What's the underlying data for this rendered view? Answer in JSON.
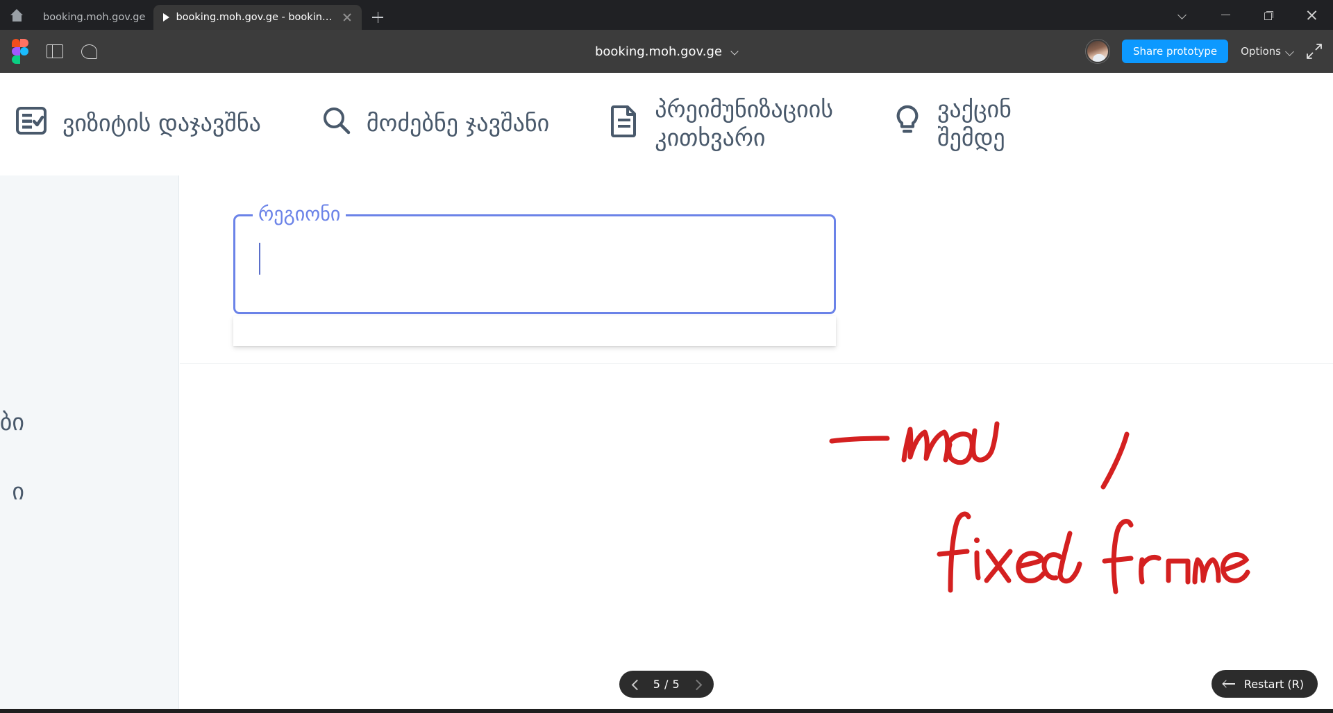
{
  "browser": {
    "home_icon": "home-icon",
    "tabs": [
      {
        "title": "booking.moh.gov.ge",
        "active": false,
        "playing": false
      },
      {
        "title": "booking.moh.gov.ge - booking.moh....",
        "active": true,
        "playing": true
      }
    ],
    "new_tab_label": "+",
    "window_controls": [
      "tab-search-chevron",
      "minimize",
      "restore",
      "close"
    ]
  },
  "figma_toolbar": {
    "logo": "figma-logo",
    "left_icons": [
      "sidebar-panel-icon",
      "comment-icon"
    ],
    "title": "booking.moh.gov.ge",
    "title_chevron": "chevron-down-icon",
    "avatar": "user-avatar",
    "share_label": "Share prototype",
    "options_label": "Options",
    "options_chevron": "chevron-down-icon",
    "fullscreen_icon": "fullscreen-icon",
    "accent_color": "#0d99ff",
    "toolbar_bg": "#3c3c3c"
  },
  "prototype": {
    "site_nav": [
      {
        "icon": "checklist-icon",
        "label": "ვიზიტის დაჯავშნა",
        "label2": ""
      },
      {
        "icon": "search-icon",
        "label": "მოძებნე ჯავშანი",
        "label2": ""
      },
      {
        "icon": "document-icon",
        "label": "პრეიმუნიზაციის",
        "label2": "კითხვარი"
      },
      {
        "icon": "lightbulb-icon",
        "label": "ვაქცინ",
        "label2": "შემდე"
      }
    ],
    "left_rail_fragments": [
      "ბი",
      "ი"
    ],
    "form": {
      "field_label": "რეგიონი",
      "field_value": "",
      "focus_color": "#6b83e8",
      "has_caret": true,
      "dropdown_open": true
    },
    "annotations": [
      {
        "text": "menu",
        "color": "#d42020"
      },
      {
        "text": "fixed frame",
        "color": "#d42020"
      },
      {
        "text": "slash-mark",
        "color": "#d42020"
      }
    ],
    "nav_text_color": "#49596b"
  },
  "controls": {
    "page_current": 5,
    "page_total": 5,
    "page_display": "5 / 5",
    "prev_icon": "chevron-left-icon",
    "next_icon": "chevron-right-icon",
    "restart_label": "Restart (R)",
    "restart_icon": "back-arrow-icon"
  }
}
